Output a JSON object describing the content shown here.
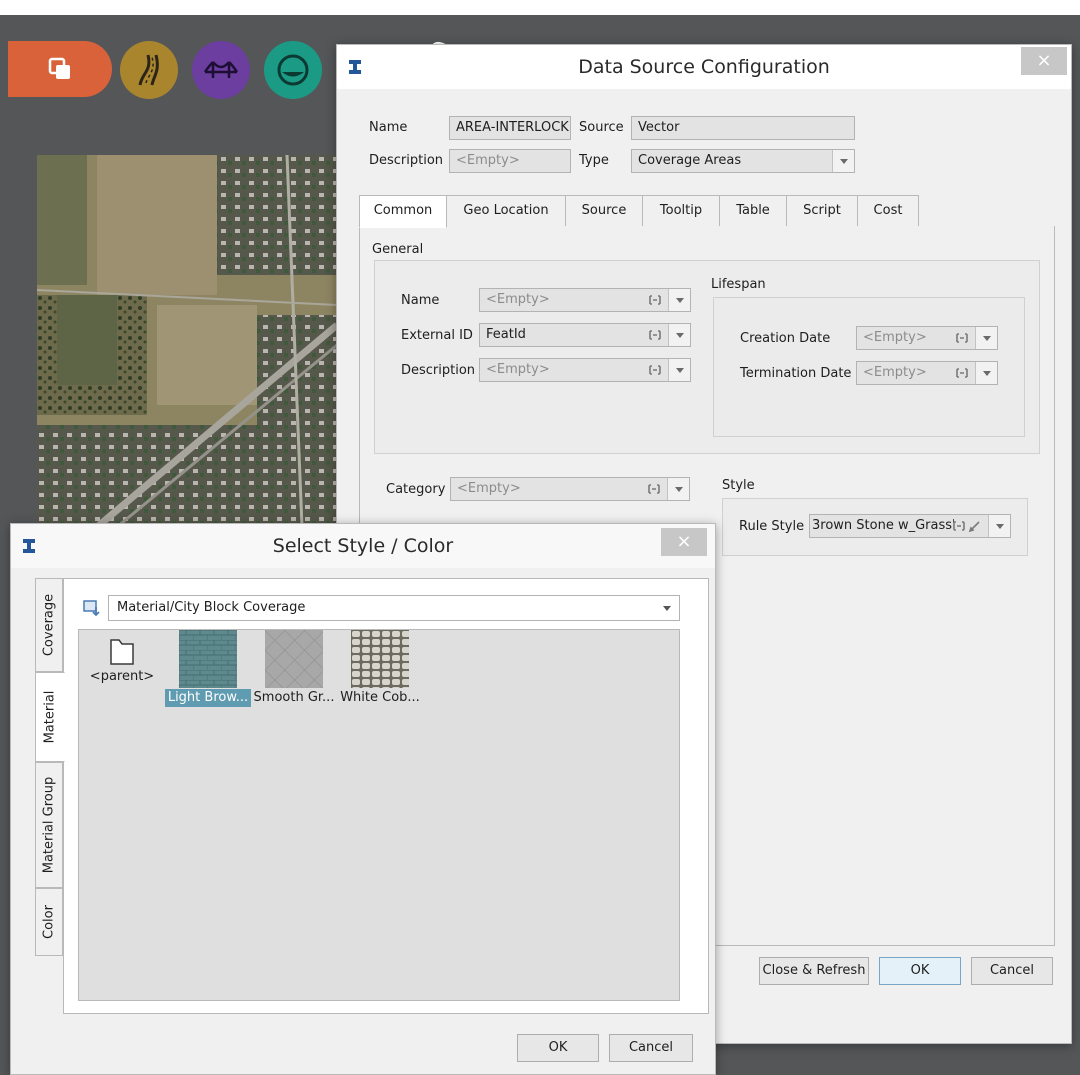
{
  "colors": {
    "toolbar_orange": "#d9623b",
    "toolbar_gold": "#a9852e",
    "toolbar_purple": "#6b3ea0",
    "toolbar_teal": "#1b9b86",
    "app_background": "#545658",
    "selection": "#5f9bb1"
  },
  "toolbar": {
    "icons": [
      "layers-icon",
      "road-icon",
      "bridge-icon",
      "water-icon",
      "camera-icon",
      "wrench-icon"
    ]
  },
  "data_source_dialog": {
    "title": "Data Source Configuration",
    "close_label": "×",
    "name_label": "Name",
    "name_value": "AREA-INTERLOCK",
    "source_label": "Source",
    "source_value": "Vector",
    "description_label": "Description",
    "description_value": "<Empty>",
    "type_label": "Type",
    "type_value": "Coverage Areas",
    "tabs": [
      "Common",
      "Geo Location",
      "Source",
      "Tooltip",
      "Table",
      "Script",
      "Cost"
    ],
    "active_tab": "Common",
    "general": {
      "title": "General",
      "name_label": "Name",
      "name_value": "<Empty>",
      "external_id_label": "External ID",
      "external_id_value": "FeatId",
      "description_label": "Description",
      "description_value": "<Empty>"
    },
    "lifespan": {
      "title": "Lifespan",
      "creation_label": "Creation Date",
      "creation_value": "<Empty>",
      "termination_label": "Termination Date",
      "termination_value": "<Empty>"
    },
    "category_label": "Category",
    "category_value": "<Empty>",
    "style": {
      "title": "Style",
      "rule_style_label": "Rule Style",
      "rule_style_value": "3rown Stone w_Grass'"
    },
    "buttons": {
      "close_refresh": "Close & Refresh",
      "ok": "OK",
      "cancel": "Cancel"
    }
  },
  "select_style_dialog": {
    "title": "Select Style / Color",
    "close_label": "×",
    "side_tabs": [
      "Coverage",
      "Material",
      "Material Group",
      "Color"
    ],
    "active_side_tab": "Material",
    "path": "Material/City Block Coverage",
    "items": [
      {
        "label": "<parent>",
        "kind": "folder"
      },
      {
        "label": "Light Brow...",
        "kind": "texture",
        "selected": true
      },
      {
        "label": "Smooth Gr...",
        "kind": "texture"
      },
      {
        "label": "White Cob...",
        "kind": "texture"
      }
    ],
    "buttons": {
      "ok": "OK",
      "cancel": "Cancel"
    }
  }
}
